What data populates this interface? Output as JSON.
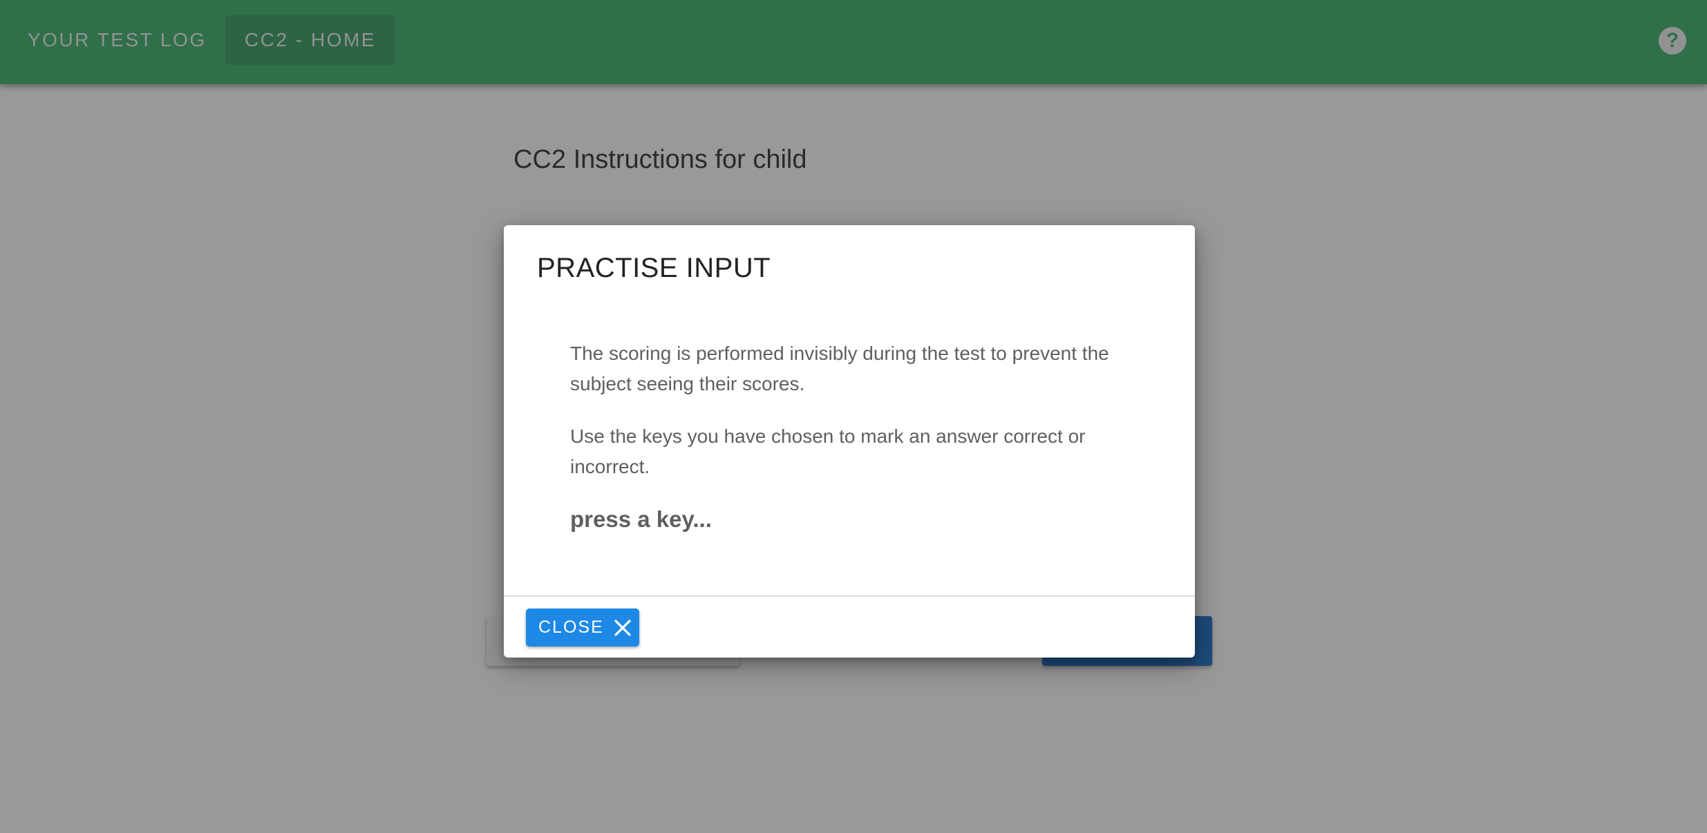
{
  "header": {
    "nav_log_label": "YOUR TEST LOG",
    "nav_home_label": "CC2 - HOME",
    "help_icon_glyph": "?"
  },
  "page": {
    "title": "CC2 Instructions for child"
  },
  "dialog": {
    "title": "PRACTISE INPUT",
    "paragraph_1": "The scoring is performed invisibly during the test to prevent the subject seeing their scores.",
    "paragraph_2": "Use the keys you have chosen to mark an answer correct or incorrect.",
    "prompt": "press a key...",
    "close_label": "CLOSE"
  },
  "colors": {
    "header_green": "#3bb46e",
    "primary_blue": "#1e88e5",
    "scrim": "rgba(33,33,33,0.46)"
  },
  "icons": {
    "help": "help-circle-icon",
    "close": "close-x-icon"
  }
}
